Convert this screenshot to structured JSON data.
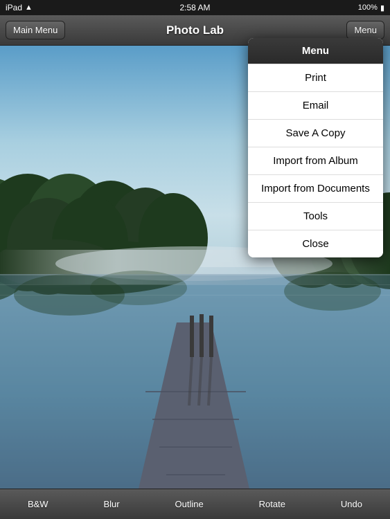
{
  "statusBar": {
    "carrier": "iPad",
    "time": "2:58 AM",
    "battery": "100%"
  },
  "navBar": {
    "leftButton": "Main Menu",
    "title": "Photo Lab",
    "rightButton": "Menu"
  },
  "menu": {
    "header": "Menu",
    "items": [
      {
        "id": "print",
        "label": "Print"
      },
      {
        "id": "email",
        "label": "Email"
      },
      {
        "id": "save-copy",
        "label": "Save A Copy"
      },
      {
        "id": "import-album",
        "label": "Import from Album"
      },
      {
        "id": "import-documents",
        "label": "Import from Documents"
      },
      {
        "id": "tools",
        "label": "Tools"
      },
      {
        "id": "close",
        "label": "Close"
      }
    ]
  },
  "bottomToolbar": {
    "buttons": [
      {
        "id": "bw",
        "label": "B&W"
      },
      {
        "id": "blur",
        "label": "Blur"
      },
      {
        "id": "outline",
        "label": "Outline"
      },
      {
        "id": "rotate",
        "label": "Rotate"
      },
      {
        "id": "undo",
        "label": "Undo"
      }
    ]
  }
}
